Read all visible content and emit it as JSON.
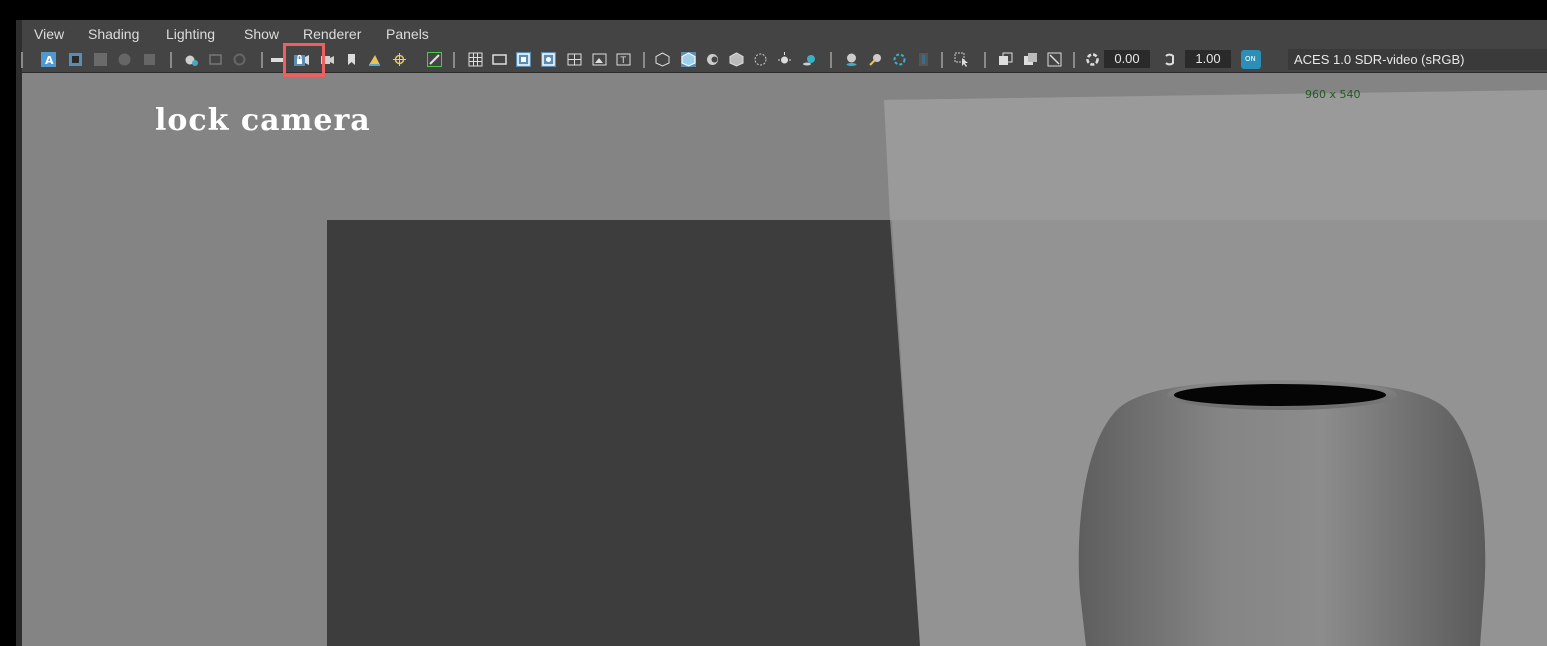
{
  "menubar": {
    "items": [
      {
        "label": "View"
      },
      {
        "label": "Shading"
      },
      {
        "label": "Lighting"
      },
      {
        "label": "Show"
      },
      {
        "label": "Renderer"
      },
      {
        "label": "Panels"
      }
    ]
  },
  "toolbar": {
    "exposure_value": "0.00",
    "gamma_value": "1.00",
    "color_management_badge": "ON",
    "color_space": "ACES 1.0 SDR-video (sRGB)",
    "icons": [
      "select-camera-icon",
      "camera-attributes-icon",
      "bookmarks-icon",
      "image-plane-icon",
      "two-d-pan-zoom-icon",
      "grease-pencil-icon",
      "lock-camera-icon",
      "camera-sequence-icon",
      "bookmark-icon",
      "grid-icon",
      "film-gate-icon",
      "resolution-gate-icon",
      "gate-mask-icon",
      "field-chart-icon",
      "safe-action-icon",
      "safe-title-icon",
      "wireframe-icon",
      "smooth-shade-icon",
      "use-default-material-icon",
      "wireframe-on-shaded-icon",
      "xray-icon",
      "use-all-lights-icon",
      "shadows-icon",
      "screen-space-ao-icon",
      "motion-blur-icon",
      "multisample-aa-icon",
      "depth-of-field-icon",
      "isolate-select-icon",
      "xray-joints-icon",
      "xray-active-components-icon",
      "hud-icon"
    ]
  },
  "viewport": {
    "resolution_label": "960 x 540"
  },
  "annotation": {
    "text": "lock camera"
  },
  "colors": {
    "highlight_box": "#ee5f5f",
    "toolbar_active": "#5a8db5",
    "viewport_background": "#848484",
    "vase": "#7a7a7a"
  }
}
